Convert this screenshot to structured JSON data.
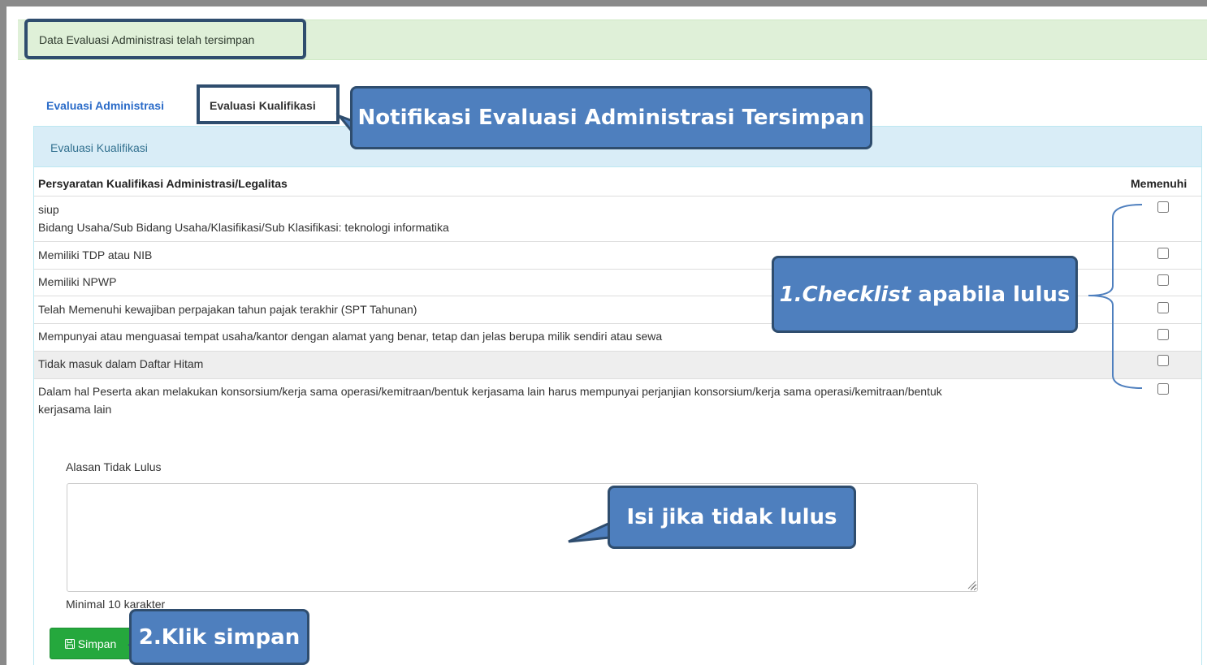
{
  "alert": {
    "message": "Data Evaluasi Administrasi telah tersimpan"
  },
  "tabs": [
    {
      "label": "Evaluasi Administrasi"
    },
    {
      "label": "Evaluasi Kualifikasi"
    }
  ],
  "panel": {
    "title": "Evaluasi Kualifikasi"
  },
  "table": {
    "headers": {
      "requirement": "Persyaratan Kualifikasi Administrasi/Legalitas",
      "fulfilled": "Memenuhi"
    },
    "rows": [
      {
        "line1": "siup",
        "line2": "Bidang Usaha/Sub Bidang Usaha/Klasifikasi/Sub Klasifikasi: teknologi informatika",
        "checked": false
      },
      {
        "line1": "Memiliki TDP atau NIB",
        "checked": false
      },
      {
        "line1": "Memiliki NPWP",
        "checked": false
      },
      {
        "line1": "Telah Memenuhi kewajiban perpajakan tahun pajak terakhir (SPT Tahunan)",
        "checked": false
      },
      {
        "line1": "Mempunyai atau menguasai tempat usaha/kantor dengan alamat yang benar, tetap dan jelas berupa milik sendiri atau sewa",
        "checked": false
      },
      {
        "line1": "Tidak masuk dalam Daftar Hitam",
        "checked": false
      },
      {
        "line1": "Dalam hal Peserta akan melakukan konsorsium/kerja sama operasi/kemitraan/bentuk kerjasama lain harus mempunyai perjanjian konsorsium/kerja sama operasi/kemitraan/bentuk",
        "line2": "kerjasama lain",
        "checked": false
      }
    ]
  },
  "form": {
    "reason_label": "Alasan Tidak Lulus",
    "reason_value": "",
    "helper": "Minimal 10 karakter",
    "save_label": "Simpan"
  },
  "callouts": {
    "notif": "Notifikasi Evaluasi Administrasi Tersimpan",
    "check_em": "1.Checklist",
    "check_rest": " apabila lulus",
    "fill": "Isi jika tidak lulus",
    "save": "2.Klik simpan"
  },
  "colors": {
    "alert_bg": "#dff0d8",
    "panel_heading_bg": "#d9edf7",
    "tab_active": "#2a6bc8",
    "save_button": "#25a83d",
    "callout_bg": "#4e7fbe",
    "callout_border": "#2f4d6e"
  },
  "icons": {
    "save": "floppy-disk-icon",
    "resize": "resize-grip-icon"
  }
}
